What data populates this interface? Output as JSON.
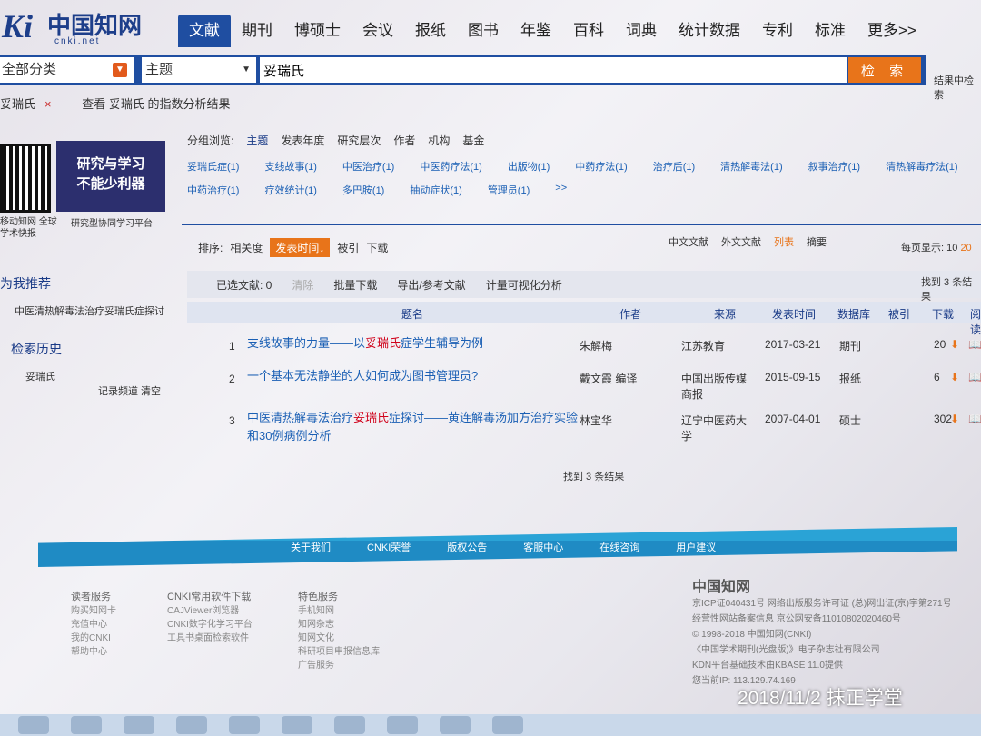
{
  "logo": {
    "ki": "Ki",
    "cn": "中国知网",
    "net": "cnki.net"
  },
  "nav_tabs": [
    "文献",
    "期刊",
    "博硕士",
    "会议",
    "报纸",
    "图书",
    "年鉴",
    "百科",
    "词典",
    "统计数据",
    "专利",
    "标准",
    "更多>>"
  ],
  "search": {
    "category": "全部分类",
    "field": "主题",
    "query": "妥瑞氏",
    "button": "检 索",
    "within": "结果中检索"
  },
  "subrow": {
    "term": "妥瑞氏",
    "remove": "×",
    "index_link": "查看 妥瑞氏 的指数分析结果"
  },
  "promo": {
    "qr_label": "移动知网 全球学术快报",
    "banner_line1": "研究与学习",
    "banner_line2": "不能少利器",
    "banner_label": "研究型协同学习平台"
  },
  "left": {
    "recommend_title": "为我推荐",
    "recommend_item": "中医清热解毒法治疗妥瑞氏症探讨",
    "history_title": "检索历史",
    "history_item": "妥瑞氏",
    "history_actions": "记录频道  清空"
  },
  "filters": {
    "group_label": "分组浏览:",
    "groups": [
      "主题",
      "发表年度",
      "研究层次",
      "作者",
      "机构",
      "基金"
    ],
    "row2": [
      "妥瑞氏症(1)",
      "支线故事(1)",
      "中医治疗(1)",
      "中医药疗法(1)",
      "出版物(1)",
      "中药疗法(1)",
      "治疗后(1)",
      "清热解毒法(1)",
      "叙事治疗(1)",
      "清热解毒疗法(1)"
    ],
    "row3": [
      "中药治疗(1)",
      "疗效统计(1)",
      "多巴胺(1)",
      "抽动症状(1)",
      "管理员(1)",
      ">>"
    ]
  },
  "sortbar": {
    "label": "排序:",
    "items": [
      "相关度",
      "发表时间↓",
      "被引",
      "下载"
    ]
  },
  "rightbar": {
    "cn": "中文文献",
    "en": "外文文献",
    "list": "列表",
    "abstract": "摘要"
  },
  "pagesize": {
    "label": "每页显示:",
    "v10": "10",
    "v20": "20"
  },
  "selbar": {
    "selected": "已选文献: 0",
    "clear": "清除",
    "batch": "批量下载",
    "export": "导出/参考文献",
    "viz": "计量可视化分析"
  },
  "found_top": "找到 3 条结果",
  "columns": [
    "题名",
    "作者",
    "来源",
    "发表时间",
    "数据库",
    "被引",
    "下载",
    "阅读"
  ],
  "rows": [
    {
      "num": "1",
      "title_a": "支线故事的力量——以",
      "title_hl": "妥瑞氏",
      "title_b": "症学生辅导为例",
      "author": "朱解梅",
      "source": "江苏教育",
      "date": "2017-03-21",
      "db": "期刊",
      "cited": "",
      "downloads": "20"
    },
    {
      "num": "2",
      "title_a": "一个基本无法静坐的人如何成为图书管理员?",
      "title_hl": "",
      "title_b": "",
      "author": "戴文霞 编译",
      "source": "中国出版传媒商报",
      "date": "2015-09-15",
      "db": "报纸",
      "cited": "",
      "downloads": "6"
    },
    {
      "num": "3",
      "title_a": "中医清热解毒法治疗",
      "title_hl": "妥瑞氏",
      "title_b": "症探讨——黄连解毒汤加方治疗实验和30例病例分析",
      "author": "林宝华",
      "source": "辽宁中医药大学",
      "date": "2007-04-01",
      "db": "硕士",
      "cited": "",
      "downloads": "302"
    }
  ],
  "found_bottom": "找到 3 条结果",
  "footer": {
    "links": [
      "关于我们",
      "CNKI荣誉",
      "版权公告",
      "客服中心",
      "在线咨询",
      "用户建议"
    ],
    "col1_h": "读者服务",
    "col1": [
      "购买知网卡",
      "充值中心",
      "我的CNKI",
      "帮助中心"
    ],
    "col2_h": "CNKI常用软件下载",
    "col2": [
      "CAJViewer浏览器",
      "CNKI数字化学习平台",
      "工具书桌面检索软件"
    ],
    "col3_h": "特色服务",
    "col3": [
      "手机知网",
      "知网杂志",
      "知网文化",
      "科研项目申报信息库",
      "广告服务"
    ],
    "corp_logo": "中国知网",
    "corp_lines": [
      "京ICP证040431号 网络出版服务许可证 (总)网出证(京)字第271号",
      "经营性网站备案信息 京公网安备11010802020460号",
      "© 1998-2018 中国知网(CNKI)",
      "《中国学术期刊(光盘版)》电子杂志社有限公司",
      "KDN平台基础技术由KBASE 11.0提供",
      "您当前IP: 113.129.74.169"
    ]
  },
  "watermark": "2018/11/2 抹正学堂"
}
